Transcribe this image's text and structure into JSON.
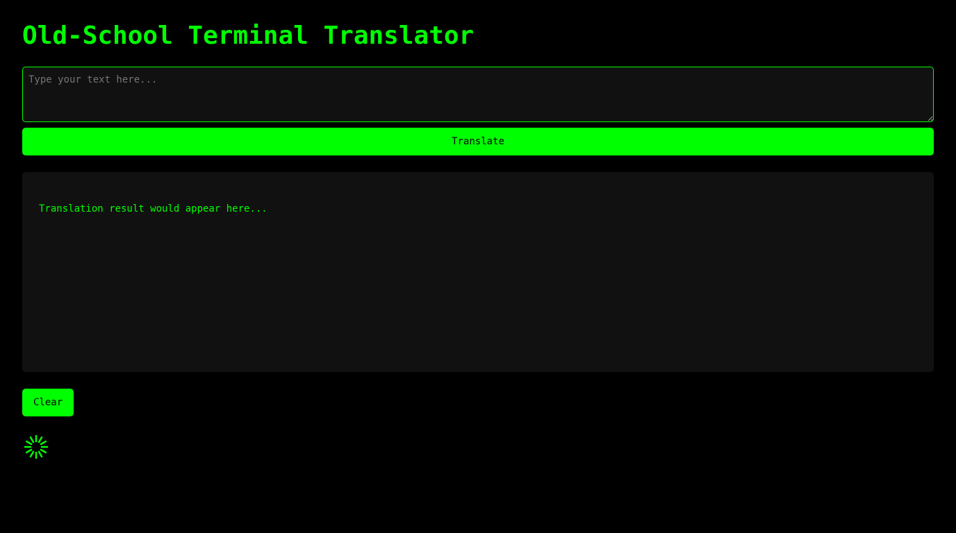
{
  "app": {
    "title": "Old-School Terminal Translator"
  },
  "input": {
    "value": "",
    "placeholder": "Type your text here..."
  },
  "actions": {
    "translate_label": "Translate",
    "clear_label": "Clear"
  },
  "result": {
    "text": "Translation result would appear here..."
  },
  "status": {
    "spinner_icon": "loading-spinner-icon"
  },
  "colors": {
    "background": "#000000",
    "accent": "#00ff00",
    "panel": "#111111",
    "placeholder": "#757575",
    "button_text": "#000000"
  }
}
